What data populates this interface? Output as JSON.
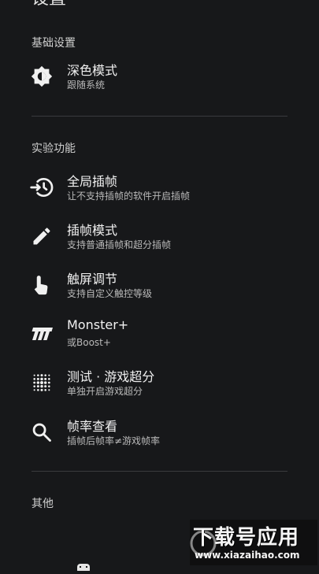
{
  "header": {
    "title": "设置"
  },
  "sections": {
    "basic": {
      "label": "基础设置",
      "items": [
        {
          "title": "深色模式",
          "subtitle": "跟随系统",
          "icon": "brightness-auto-icon"
        }
      ]
    },
    "experimental": {
      "label": "实验功能",
      "items": [
        {
          "title": "全局插帧",
          "subtitle": "让不支持插帧的软件开启插帧",
          "icon": "global-interpolation-icon"
        },
        {
          "title": "插帧模式",
          "subtitle": "支持普通插帧和超分插帧",
          "icon": "pencil-icon"
        },
        {
          "title": "触屏调节",
          "subtitle": "支持自定义触控等级",
          "icon": "touch-hand-icon"
        },
        {
          "title": "Monster+",
          "subtitle": "或Boost+",
          "icon": "monster-logo-icon"
        },
        {
          "title": "测试 · 游戏超分",
          "subtitle": "单独开启游戏超分",
          "icon": "dot-grid-icon"
        },
        {
          "title": "帧率查看",
          "subtitle": "插帧后帧率≠游戏帧率",
          "icon": "search-icon"
        }
      ]
    },
    "other": {
      "label": "其他"
    }
  },
  "watermark": {
    "title": "下载号应用",
    "url": "www.xiazaihao.com"
  },
  "colors": {
    "background": "#17181a",
    "text": "#f1f1f1",
    "secondary_text": "#b9b9b9",
    "divider": "#3a3b3e"
  }
}
